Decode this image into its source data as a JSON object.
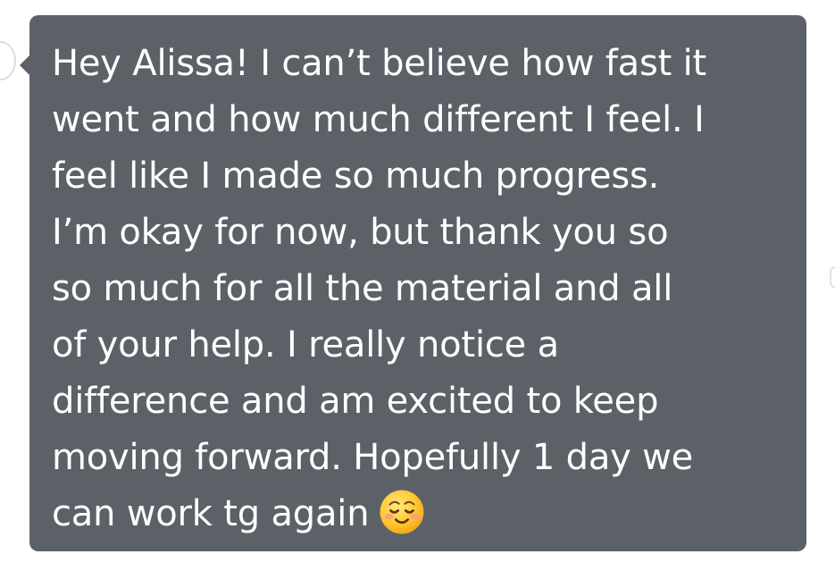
{
  "message": {
    "lines": [
      "Hey Alissa! I can’t believe how fast it",
      "went and how much different I feel. I",
      "feel like I made so much progress.",
      "I’m okay for now, but thank you so",
      "so much for all the material and all",
      "of your help. I really notice a",
      "difference and am excited to keep",
      "moving forward. Hopefully 1 day we",
      "can work tg again"
    ],
    "emoji": "smiling-face-emoji"
  },
  "colors": {
    "bubble": "#5c6168",
    "text": "#ffffff",
    "background": "#ffffff"
  }
}
